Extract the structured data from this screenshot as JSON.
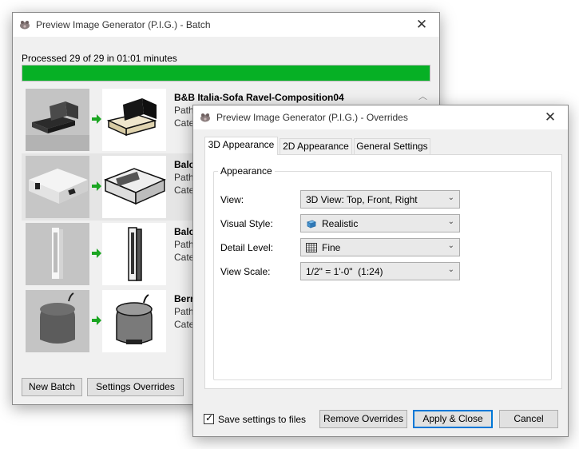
{
  "batch_window": {
    "title": "Preview Image Generator (P.I.G.) - Batch",
    "close_glyph": "✕",
    "progress_text": "Processed 29 of 29 in 01:01 minutes",
    "progress_fraction": 1.0,
    "progress_color": "#06b025",
    "items": [
      {
        "name": "B&B Italia-Sofa Ravel-Composition04",
        "path_label": "Path",
        "category_label": "Cate",
        "thumbnail": "sofa-composition"
      },
      {
        "name": "Balc",
        "path_label": "Path",
        "category_label": "Cate",
        "thumbnail": "balcony-planter-box"
      },
      {
        "name": "Balc",
        "path_label": "Path",
        "category_label": "Cate",
        "thumbnail": "balcony-column"
      },
      {
        "name": "Berr",
        "path_label": "Path",
        "category_label": "Cate",
        "thumbnail": "round-pouf"
      }
    ],
    "new_batch_label": "New Batch",
    "settings_overrides_label": "Settings Overrides"
  },
  "overrides_dialog": {
    "title": "Preview Image Generator (P.I.G.) - Overrides",
    "close_glyph": "✕",
    "tabs": [
      {
        "label": "3D Appearance",
        "active": true
      },
      {
        "label": "2D Appearance",
        "active": false
      },
      {
        "label": "General Settings",
        "active": false
      }
    ],
    "group_title": "Appearance",
    "fields": {
      "view": {
        "label": "View:",
        "value": "3D View: Top, Front, Right"
      },
      "visual_style": {
        "label": "Visual Style:",
        "value": "Realistic",
        "icon": "realistic-style-icon"
      },
      "detail_level": {
        "label": "Detail Level:",
        "value": "Fine",
        "icon": "fine-detail-icon"
      },
      "view_scale": {
        "label": "View Scale:",
        "value": "1/2\" = 1'-0\"  (1:24)"
      }
    },
    "save_settings_label": "Save settings to files",
    "save_settings_checked": true,
    "remove_overrides_label": "Remove Overrides",
    "apply_close_label": "Apply & Close",
    "cancel_label": "Cancel"
  },
  "colors": {
    "accent_blue": "#0078d7",
    "progress_green": "#06b025",
    "arrow_green": "#1aa521"
  }
}
